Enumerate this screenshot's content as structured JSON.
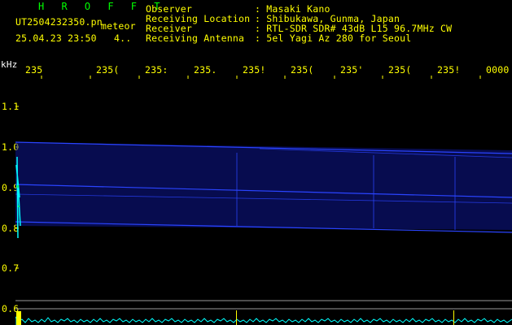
{
  "header": {
    "title": "H R O F F T",
    "filename": "UT2504232350.pn",
    "tag": "meteor",
    "datetime": "25.04.23 23:50",
    "count": "4..",
    "info": [
      {
        "label": "Observer",
        "value": ": Masaki Kano"
      },
      {
        "label": "Receiving Location",
        "value": ": Shibukawa, Gunma, Japan"
      },
      {
        "label": "Receiver",
        "value": ": RTL-SDR SDR# 43dB L15 96.7MHz CW"
      },
      {
        "label": "Receiving Antenna",
        "value": ": 5el Yagi Az 280 for Seoul"
      }
    ]
  },
  "axis": {
    "y_unit": "kHz",
    "x_ticks": [
      "235",
      "235(",
      "235:",
      "235.",
      "235!",
      "235(",
      "235'",
      "235(",
      "235!",
      "0000"
    ],
    "y_ticks": [
      "1.1",
      "1.0",
      "0.9",
      "0.8",
      "0.7",
      "0.6"
    ]
  },
  "colors": {
    "background": "#000000",
    "text": "#ffff00",
    "title": "#00ff00",
    "signal": "#1f3cff",
    "echo": "#00ffff",
    "marker": "#ffff00",
    "baseline": "#9a9a9a"
  }
}
